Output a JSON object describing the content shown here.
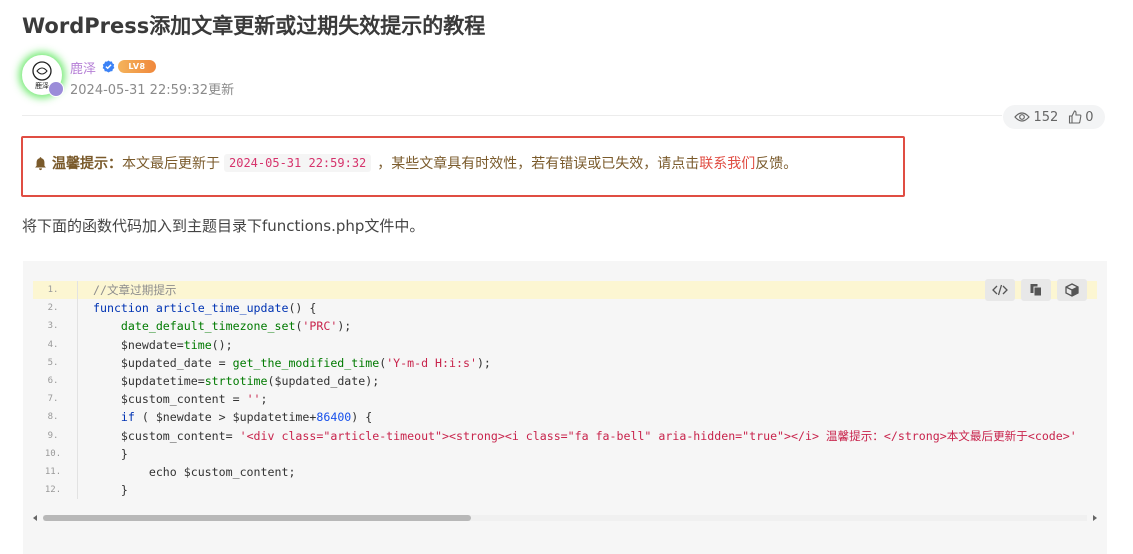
{
  "article": {
    "title": "WordPress添加文章更新或过期失效提示的教程"
  },
  "author": {
    "name": "鹿泽",
    "level": "LV8",
    "avatar_text": "鹿泽",
    "update_time": "2024-05-31 22:59:32更新"
  },
  "stats": {
    "views": "152",
    "likes": "0"
  },
  "notice": {
    "label": "温馨提示：",
    "text_before": "本文最后更新于",
    "date": "2024-05-31 22:59:32",
    "text_after": "，某些文章具有时效性，若有错误或已失效，请点击",
    "link_text": "联系我们",
    "text_end": "反馈。"
  },
  "intro": "将下面的函数代码加入到主题目录下functions.php文件中。",
  "code": {
    "lines": [
      {
        "n": "1.",
        "segs": [
          {
            "t": "//文章过期提示",
            "c": "comment"
          }
        ]
      },
      {
        "n": "2.",
        "segs": [
          {
            "t": "function",
            "c": "kw"
          },
          {
            "t": " ",
            "c": "var"
          },
          {
            "t": "article_time_update",
            "c": "kw"
          },
          {
            "t": "() {",
            "c": "var"
          }
        ]
      },
      {
        "n": "3.",
        "segs": [
          {
            "t": "    ",
            "c": "var"
          },
          {
            "t": "date_default_timezone_set",
            "c": "fn"
          },
          {
            "t": "(",
            "c": "var"
          },
          {
            "t": "'PRC'",
            "c": "str"
          },
          {
            "t": ");",
            "c": "var"
          }
        ]
      },
      {
        "n": "4.",
        "segs": [
          {
            "t": "    $newdate=",
            "c": "var"
          },
          {
            "t": "time",
            "c": "fn"
          },
          {
            "t": "();",
            "c": "var"
          }
        ]
      },
      {
        "n": "5.",
        "segs": [
          {
            "t": "    $updated_date = ",
            "c": "var"
          },
          {
            "t": "get_the_modified_time",
            "c": "fn"
          },
          {
            "t": "(",
            "c": "var"
          },
          {
            "t": "'Y-m-d H:i:s'",
            "c": "str"
          },
          {
            "t": ");",
            "c": "var"
          }
        ]
      },
      {
        "n": "6.",
        "segs": [
          {
            "t": "    $updatetime=",
            "c": "var"
          },
          {
            "t": "strtotime",
            "c": "fn"
          },
          {
            "t": "($updated_date);",
            "c": "var"
          }
        ]
      },
      {
        "n": "7.",
        "segs": [
          {
            "t": "    $custom_content = ",
            "c": "var"
          },
          {
            "t": "''",
            "c": "str"
          },
          {
            "t": ";",
            "c": "var"
          }
        ]
      },
      {
        "n": "8.",
        "segs": [
          {
            "t": "    ",
            "c": "var"
          },
          {
            "t": "if",
            "c": "kw"
          },
          {
            "t": " ( $newdate > $updatetime+",
            "c": "var"
          },
          {
            "t": "86400",
            "c": "num"
          },
          {
            "t": ") {",
            "c": "var"
          }
        ]
      },
      {
        "n": "9.",
        "segs": [
          {
            "t": "    $custom_content= ",
            "c": "var"
          },
          {
            "t": "'<div class=\"article-timeout\"><strong><i class=\"fa fa-bell\" aria-hidden=\"true\"></i> 温馨提示：</strong>本文最后更新于<code>'",
            "c": "str"
          }
        ]
      },
      {
        "n": "10.",
        "segs": [
          {
            "t": "    }",
            "c": "var"
          }
        ]
      },
      {
        "n": "11.",
        "segs": [
          {
            "t": "        echo $custom_content;",
            "c": "var"
          }
        ]
      },
      {
        "n": "12.",
        "segs": [
          {
            "t": "    }",
            "c": "var"
          }
        ]
      }
    ],
    "highlighted_line": 1,
    "scroll_position": 0.41
  },
  "icons": {
    "view": "eye-icon",
    "like": "thumbs-up-icon",
    "bell": "bell-icon",
    "verified": "verified-icon",
    "code_view": "code-icon",
    "copy": "copy-icon",
    "box": "box-icon"
  },
  "colors": {
    "notice_border": "#e04d43",
    "link": "#e04d43",
    "author_name": "#b57fd6"
  }
}
